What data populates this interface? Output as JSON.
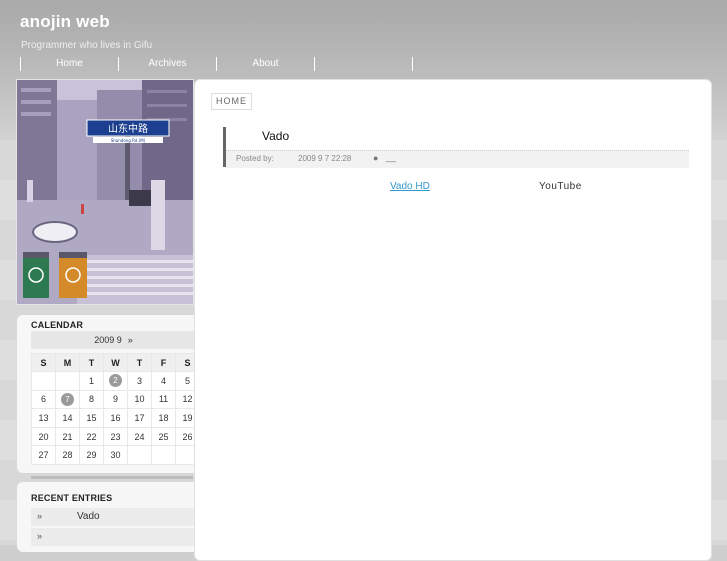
{
  "site": {
    "title": "anojin web",
    "tagline": "Programmer who lives in Gifu"
  },
  "nav": {
    "items": [
      {
        "label": "Home"
      },
      {
        "label": "Archives"
      },
      {
        "label": "About"
      },
      {
        "label": ""
      }
    ]
  },
  "sidebar_photo": {
    "sign_text": "山东中路",
    "sign_subtext": "Shandong Rd.(M)"
  },
  "calendar": {
    "title": "CALENDAR",
    "month": "2009 9",
    "next": "»",
    "weekdays": [
      "S",
      "M",
      "T",
      "W",
      "T",
      "F",
      "S"
    ],
    "weeks": [
      [
        "",
        "",
        "1",
        "2",
        "3",
        "4",
        "5"
      ],
      [
        "6",
        "7",
        "8",
        "9",
        "10",
        "11",
        "12"
      ],
      [
        "13",
        "14",
        "15",
        "16",
        "17",
        "18",
        "19"
      ],
      [
        "20",
        "21",
        "22",
        "23",
        "24",
        "25",
        "26"
      ],
      [
        "27",
        "28",
        "29",
        "30",
        "",
        "",
        ""
      ]
    ],
    "highlighted_days": [
      "2",
      "7"
    ]
  },
  "recent": {
    "title": "RECENT ENTRIES",
    "items": [
      {
        "arrow": "»",
        "title": "Vado"
      },
      {
        "arrow": "»",
        "title": ""
      }
    ]
  },
  "breadcrumb": "HOME",
  "post": {
    "title": "Vado",
    "posted_by_label": "Posted by:",
    "date": "2009 9  7  22:28",
    "bullet": "●",
    "category": "__",
    "link_text": "Vado HD",
    "trailing_text": "YouTube"
  },
  "colors": {
    "header_bg": "#b0b0b0",
    "link": "#3399cc",
    "highlight_day": "#9a9a9a"
  }
}
